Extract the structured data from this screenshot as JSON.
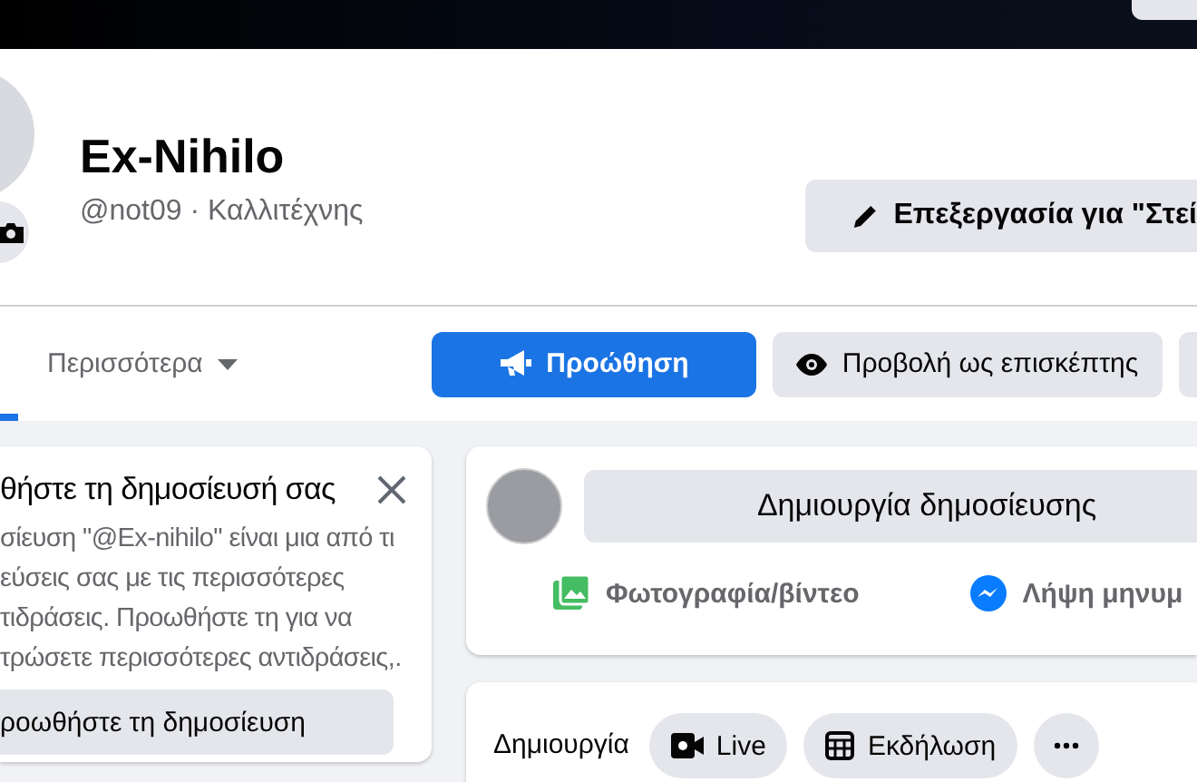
{
  "profile": {
    "name": "Ex-Nihilo",
    "subtitle": "@not09 · Καλλιτέχνης",
    "edit_button": "Επεξεργασία για \"Στεί"
  },
  "tabs": [
    {
      "label": "Περισσότερα",
      "selected": false
    }
  ],
  "actions": [
    {
      "label": "Προώθηση",
      "kind": "primary"
    },
    {
      "label": "Προβολή ως επισκέπτης",
      "kind": "secondary"
    }
  ],
  "promo_card": {
    "title": "θήστε τη δημοσίευσή σας",
    "body": "σίευση \"@Ex-nihilo\" είναι μια από τι\nεύσεις σας με τις περισσότερες\nτιδράσεις. Προωθήστε τη για να\nτρώσετε περισσότερες αντιδράσεις,.",
    "button": "ροωθήστε τη δημοσίευση"
  },
  "composer": {
    "button": "Δημιουργία δημοσίευσης",
    "options": [
      {
        "label": "Φωτογραφία/βίντεο",
        "kind": "photo"
      },
      {
        "label": "Λήψη μηνυμ",
        "kind": "messenger"
      }
    ]
  },
  "create_bar": {
    "label": "Δημιουργία",
    "chips": [
      {
        "label": "Live",
        "kind": "live"
      },
      {
        "label": "Εκδήλωση",
        "kind": "event"
      }
    ]
  }
}
